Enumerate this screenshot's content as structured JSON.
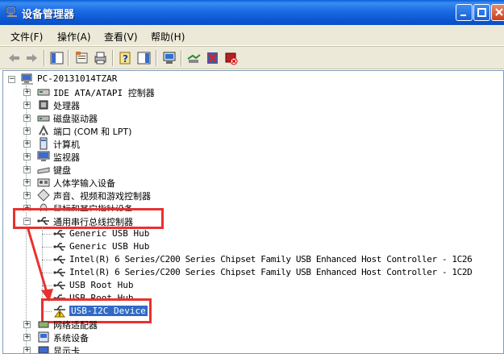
{
  "window": {
    "title": "设备管理器"
  },
  "menu": [
    "文件(F)",
    "操作(A)",
    "查看(V)",
    "帮助(H)"
  ],
  "tree": {
    "root": "PC-20131014TZAR",
    "categories": [
      {
        "label": "IDE ATA/ATAPI 控制器",
        "icon": "ide-controller-icon"
      },
      {
        "label": "处理器",
        "icon": "processor-icon"
      },
      {
        "label": "磁盘驱动器",
        "icon": "disk-drive-icon"
      },
      {
        "label": "端口 (COM 和 LPT)",
        "icon": "port-icon"
      },
      {
        "label": "计算机",
        "icon": "computer-icon"
      },
      {
        "label": "监视器",
        "icon": "monitor-icon"
      },
      {
        "label": "键盘",
        "icon": "keyboard-icon"
      },
      {
        "label": "人体学输入设备",
        "icon": "hid-icon"
      },
      {
        "label": "声音、视频和游戏控制器",
        "icon": "sound-icon"
      },
      {
        "label": "鼠标和其它指针设备",
        "icon": "mouse-icon"
      }
    ],
    "usb_category": "通用串行总线控制器",
    "usb_children": [
      "Generic USB Hub",
      "Generic USB Hub",
      "Intel(R) 6 Series/C200 Series Chipset Family USB Enhanced Host Controller - 1C26",
      "Intel(R) 6 Series/C200 Series Chipset Family USB Enhanced Host Controller - 1C2D",
      "USB Root Hub",
      "USB Root Hub"
    ],
    "selected_device": "USB-I2C Device",
    "after": [
      {
        "label": "网络适配器",
        "icon": "network-adapter-icon"
      },
      {
        "label": "系统设备",
        "icon": "system-device-icon"
      },
      {
        "label": "显示卡",
        "icon": "display-adapter-icon"
      }
    ]
  },
  "colors": {
    "highlight": "#e8312f",
    "selection": "#316ac5",
    "title_bar": "#0b57d0"
  }
}
